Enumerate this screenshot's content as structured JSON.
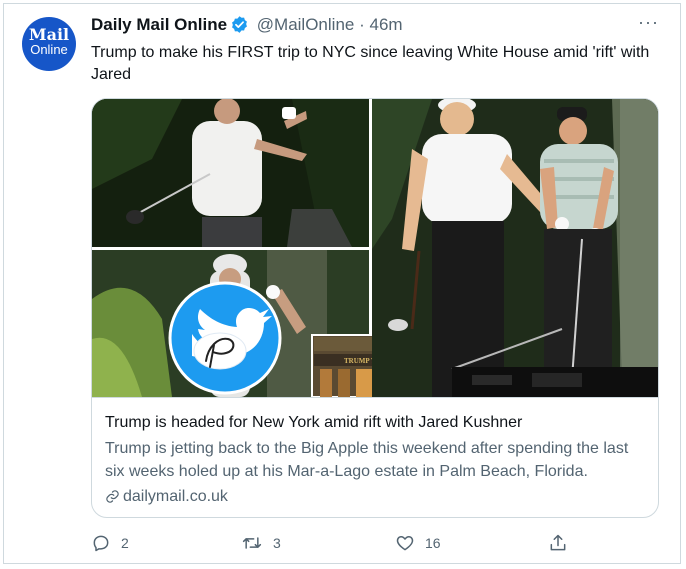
{
  "tweet": {
    "avatar": {
      "line1": "Mail",
      "line2": "Online",
      "color": "#1656c8"
    },
    "author_name": "Daily Mail Online",
    "handle": "@MailOnline",
    "separator": "·",
    "time": "46m",
    "more": "···",
    "text": "Trump to make his FIRST trip to NYC since leaving White House amid 'rift' with Jared",
    "verified_color": "#1d9bf0"
  },
  "card": {
    "image": {
      "sign_text": "TRUMP TOWER"
    },
    "title": "Trump is headed for New York amid rift with Jared Kushner",
    "description": "Trump is jetting back to the Big Apple this weekend after spending the last six weeks holed up at his Mar-a-Lago estate in Palm Beach, Florida.",
    "domain": "dailymail.co.uk"
  },
  "actions": {
    "replies": "2",
    "retweets": "3",
    "likes": "16"
  }
}
